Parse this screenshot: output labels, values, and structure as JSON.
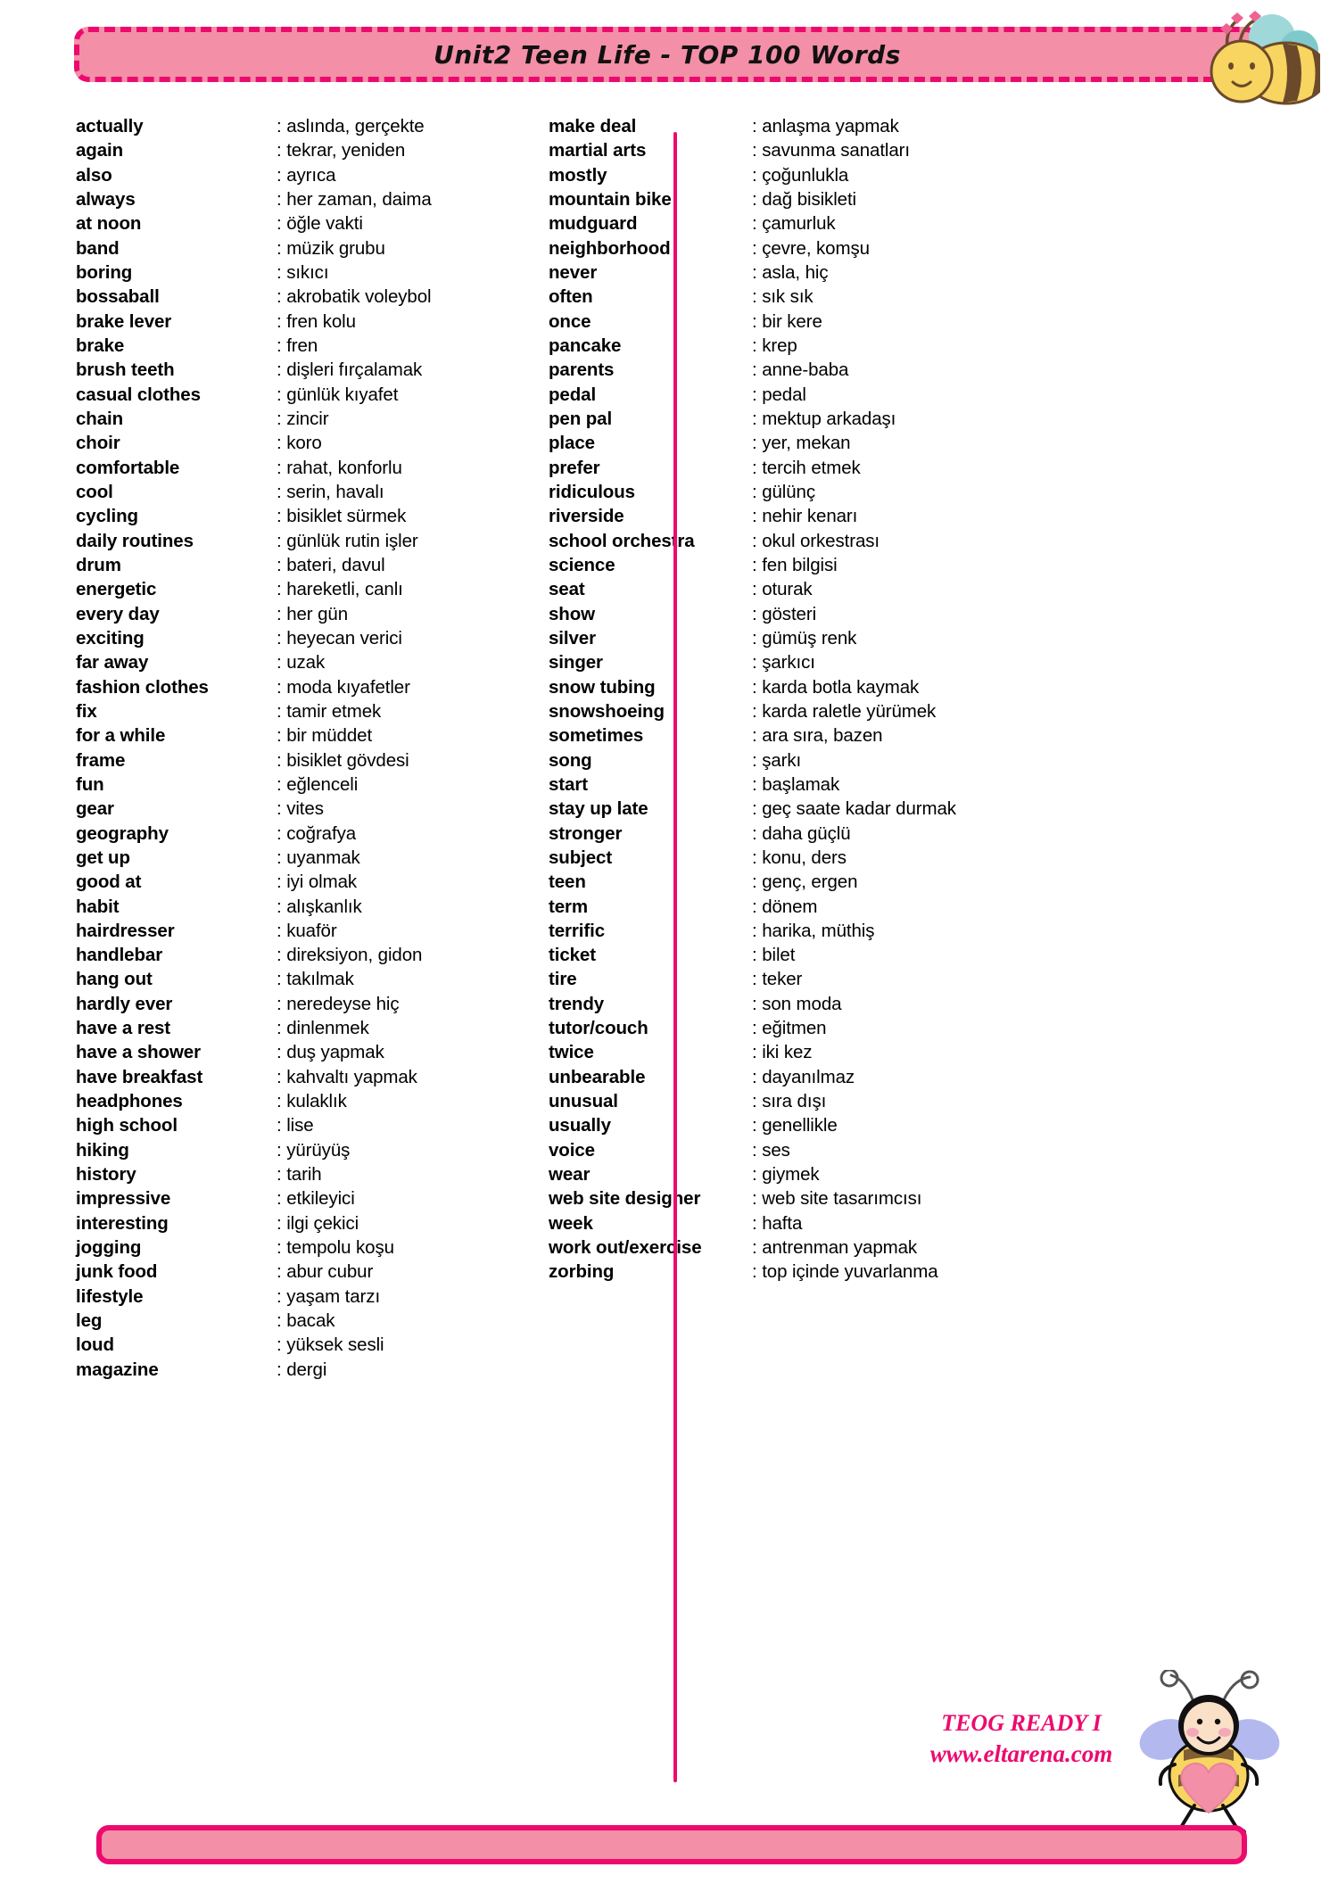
{
  "header": {
    "title": "Unit2 Teen Life - TOP 100 Words",
    "bee_icon": "bee-icon"
  },
  "colors": {
    "banner_fill": "#f48fa8",
    "banner_border": "#ec0a6e",
    "accent_pink": "#ec0a6e",
    "text": "#000000",
    "bee_body": "#f7d560",
    "bee_stripe": "#6b4a2b",
    "bee_wing_top": "#9fd8d8",
    "bee_wing_bottom": "#a9b0e8",
    "heart": "#f48fa8"
  },
  "separator": ":",
  "left_column": [
    {
      "word": "actually",
      "meaning": "aslında, gerçekte"
    },
    {
      "word": "again",
      "meaning": "tekrar, yeniden"
    },
    {
      "word": "also",
      "meaning": "ayrıca"
    },
    {
      "word": "always",
      "meaning": "her zaman, daima"
    },
    {
      "word": "at noon",
      "meaning": "öğle vakti"
    },
    {
      "word": "band",
      "meaning": "müzik grubu"
    },
    {
      "word": "boring",
      "meaning": "sıkıcı"
    },
    {
      "word": "bossaball",
      "meaning": "akrobatik voleybol"
    },
    {
      "word": "brake lever",
      "meaning": "fren kolu"
    },
    {
      "word": "brake",
      "meaning": "fren"
    },
    {
      "word": "brush teeth",
      "meaning": "dişleri fırçalamak"
    },
    {
      "word": "casual clothes",
      "meaning": "günlük kıyafet"
    },
    {
      "word": "chain",
      "meaning": "zincir"
    },
    {
      "word": "choir",
      "meaning": "koro"
    },
    {
      "word": "comfortable",
      "meaning": "rahat, konforlu"
    },
    {
      "word": "cool",
      "meaning": "serin, havalı"
    },
    {
      "word": "cycling",
      "meaning": "bisiklet sürmek"
    },
    {
      "word": "daily routines",
      "meaning": "günlük rutin işler"
    },
    {
      "word": "drum",
      "meaning": "bateri, davul"
    },
    {
      "word": "energetic",
      "meaning": "hareketli, canlı"
    },
    {
      "word": "every day",
      "meaning": "her gün"
    },
    {
      "word": "exciting",
      "meaning": "heyecan verici"
    },
    {
      "word": "far away",
      "meaning": "uzak"
    },
    {
      "word": "fashion clothes",
      "meaning": "moda kıyafetler"
    },
    {
      "word": "fix",
      "meaning": "tamir etmek"
    },
    {
      "word": "for a while",
      "meaning": "bir müddet"
    },
    {
      "word": "frame",
      "meaning": "bisiklet gövdesi"
    },
    {
      "word": "fun",
      "meaning": "eğlenceli"
    },
    {
      "word": "gear",
      "meaning": "vites"
    },
    {
      "word": "geography",
      "meaning": "coğrafya"
    },
    {
      "word": "get up",
      "meaning": "uyanmak"
    },
    {
      "word": "good at",
      "meaning": "iyi olmak"
    },
    {
      "word": "habit",
      "meaning": "alışkanlık"
    },
    {
      "word": "hairdresser",
      "meaning": "kuaför"
    },
    {
      "word": "handlebar",
      "meaning": "direksiyon, gidon"
    },
    {
      "word": "hang out",
      "meaning": "takılmak"
    },
    {
      "word": "hardly ever",
      "meaning": "neredeyse hiç"
    },
    {
      "word": "have a rest",
      "meaning": "dinlenmek"
    },
    {
      "word": "have a shower",
      "meaning": "duş yapmak"
    },
    {
      "word": "have breakfast",
      "meaning": "kahvaltı yapmak"
    },
    {
      "word": "headphones",
      "meaning": "kulaklık"
    },
    {
      "word": "high school",
      "meaning": "lise"
    },
    {
      "word": "hiking",
      "meaning": "yürüyüş"
    },
    {
      "word": "history",
      "meaning": "tarih"
    },
    {
      "word": "impressive",
      "meaning": "etkileyici"
    },
    {
      "word": "interesting",
      "meaning": "ilgi çekici"
    },
    {
      "word": "jogging",
      "meaning": "tempolu koşu"
    },
    {
      "word": "junk food",
      "meaning": "abur cubur"
    },
    {
      "word": "lifestyle",
      "meaning": "yaşam tarzı"
    },
    {
      "word": "leg",
      "meaning": "bacak"
    },
    {
      "word": "loud",
      "meaning": "yüksek sesli"
    },
    {
      "word": "magazine",
      "meaning": "dergi"
    }
  ],
  "right_column": [
    {
      "word": "make deal",
      "meaning": "anlaşma yapmak"
    },
    {
      "word": "martial arts",
      "meaning": "savunma sanatları"
    },
    {
      "word": "mostly",
      "meaning": "çoğunlukla"
    },
    {
      "word": "mountain bike",
      "meaning": "dağ bisikleti"
    },
    {
      "word": "mudguard",
      "meaning": "çamurluk"
    },
    {
      "word": "neighborhood",
      "meaning": "çevre, komşu"
    },
    {
      "word": "never",
      "meaning": "asla, hiç"
    },
    {
      "word": "often",
      "meaning": "sık sık"
    },
    {
      "word": "once",
      "meaning": "bir kere"
    },
    {
      "word": "pancake",
      "meaning": "krep"
    },
    {
      "word": "parents",
      "meaning": "anne-baba"
    },
    {
      "word": "pedal",
      "meaning": "pedal"
    },
    {
      "word": "pen pal",
      "meaning": "mektup arkadaşı"
    },
    {
      "word": "place",
      "meaning": "yer, mekan"
    },
    {
      "word": "prefer",
      "meaning": "tercih etmek"
    },
    {
      "word": "ridiculous",
      "meaning": "gülünç"
    },
    {
      "word": "riverside",
      "meaning": "nehir kenarı"
    },
    {
      "word": "school orchestra",
      "meaning": "okul orkestrası"
    },
    {
      "word": "science",
      "meaning": "fen bilgisi"
    },
    {
      "word": "seat",
      "meaning": "oturak"
    },
    {
      "word": "show",
      "meaning": "gösteri"
    },
    {
      "word": "silver",
      "meaning": "gümüş renk"
    },
    {
      "word": "singer",
      "meaning": "şarkıcı"
    },
    {
      "word": "snow tubing",
      "meaning": "karda botla kaymak"
    },
    {
      "word": "snowshoeing",
      "meaning": "karda raletle yürümek"
    },
    {
      "word": "sometimes",
      "meaning": "ara sıra, bazen"
    },
    {
      "word": "song",
      "meaning": "şarkı"
    },
    {
      "word": "start",
      "meaning": "başlamak"
    },
    {
      "word": "stay up late",
      "meaning": "geç saate kadar durmak"
    },
    {
      "word": "stronger",
      "meaning": "daha güçlü"
    },
    {
      "word": "subject",
      "meaning": "konu, ders"
    },
    {
      "word": "teen",
      "meaning": "genç, ergen"
    },
    {
      "word": "term",
      "meaning": "dönem"
    },
    {
      "word": "terrific",
      "meaning": "harika, müthiş"
    },
    {
      "word": "ticket",
      "meaning": "bilet"
    },
    {
      "word": "tire",
      "meaning": "teker"
    },
    {
      "word": "trendy",
      "meaning": "son moda"
    },
    {
      "word": "tutor/couch",
      "meaning": "eğitmen"
    },
    {
      "word": "twice",
      "meaning": "iki kez"
    },
    {
      "word": "unbearable",
      "meaning": "dayanılmaz"
    },
    {
      "word": "unusual",
      "meaning": "sıra dışı"
    },
    {
      "word": "usually",
      "meaning": "genellikle"
    },
    {
      "word": "voice",
      "meaning": "ses"
    },
    {
      "word": "wear",
      "meaning": "giymek"
    },
    {
      "word": "web site designer",
      "meaning": "web site tasarımcısı"
    },
    {
      "word": "week",
      "meaning": "hafta"
    },
    {
      "word": "work out/exercise",
      "meaning": "antrenman yapmak"
    },
    {
      "word": "zorbing",
      "meaning": "top içinde yuvarlanma"
    }
  ],
  "footer": {
    "brand_line1": "TEOG READY I",
    "brand_line2": "www.eltarena.com",
    "bee_icon": "bee-with-heart-icon"
  }
}
